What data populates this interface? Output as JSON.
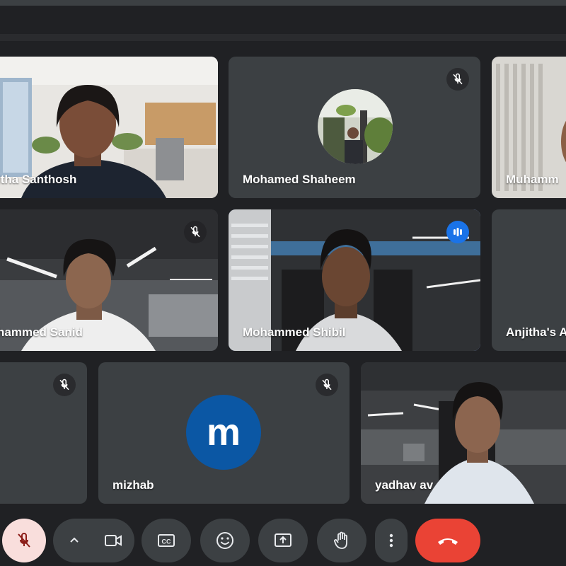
{
  "participants": [
    {
      "name": "itha Santhosh"
    },
    {
      "name": "Mohamed Shaheem"
    },
    {
      "name": "Muhamm"
    },
    {
      "name": "hammed Sanid"
    },
    {
      "name": "Mohammed Shibil"
    },
    {
      "name": "Anjitha's A"
    },
    {
      "name": ""
    },
    {
      "name": "mizhab",
      "avatar_letter": "m"
    },
    {
      "name": "yadhav av"
    }
  ],
  "controls": {
    "mic": "mic-muted-icon",
    "more_options": "chevron-up-icon",
    "camera": "video-camera-icon",
    "captions": "CC",
    "reactions": "emoji-icon",
    "present": "present-screen-icon",
    "raise_hand": "hand-icon",
    "more": "more-vert-icon",
    "leave": "hang-up-icon"
  },
  "colors": {
    "background": "#202124",
    "tile": "#3c4043",
    "active_outline": "#8ab4f8",
    "speaking_badge": "#1a73e8",
    "avatar_mizhab": "#0b57a4",
    "leave_button": "#ea4335",
    "mic_muted_button": "#f9dedc"
  }
}
